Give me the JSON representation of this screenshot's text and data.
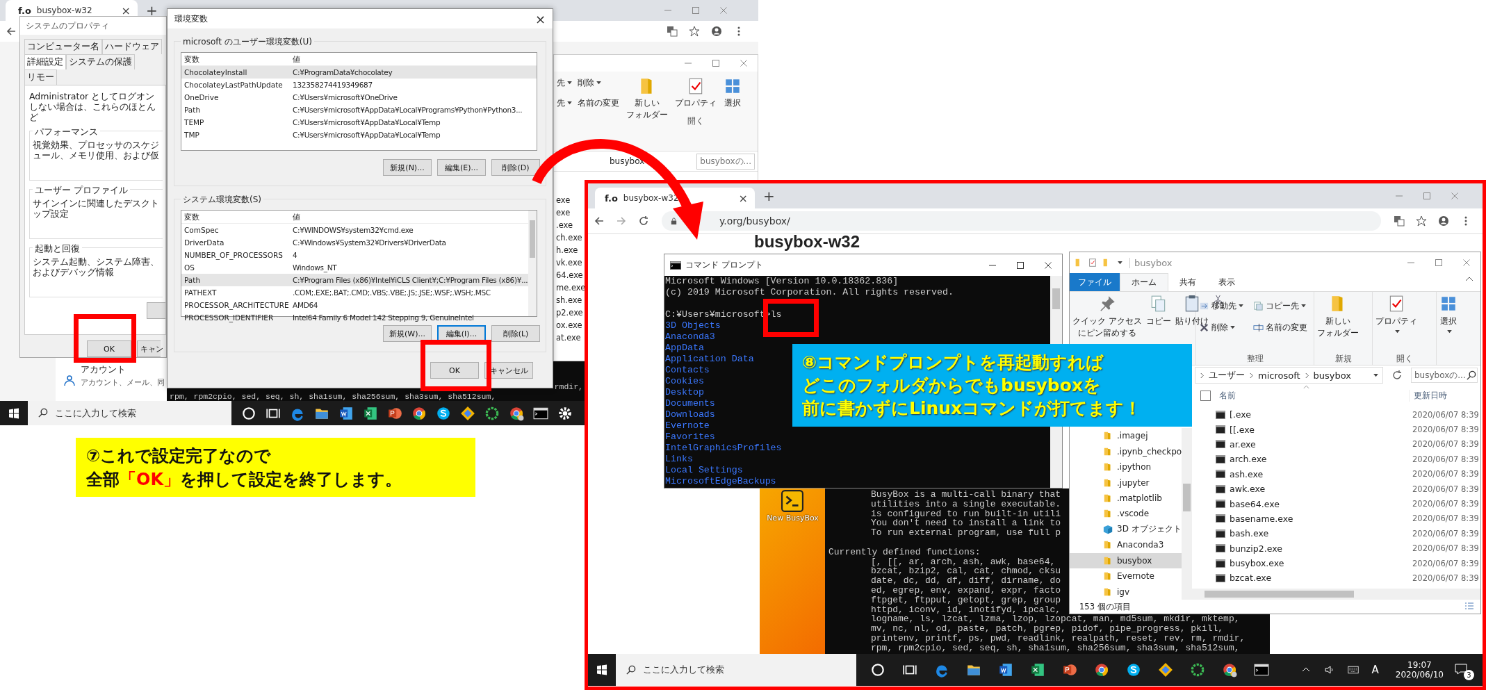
{
  "left_screenshot": {
    "browser_tab": {
      "logo": "f.o",
      "title": "busybox-w32",
      "close": "×",
      "new_tab": "+"
    },
    "system_properties": {
      "title": "システムのプロパティ",
      "tabs": [
        {
          "label": "コンピューター名",
          "selected": false
        },
        {
          "label": "ハードウェア",
          "selected": false
        },
        {
          "label": "詳細設定",
          "selected": true
        },
        {
          "label": "システムの保護",
          "selected": false
        },
        {
          "label": "リモー",
          "selected": false
        }
      ],
      "intro": "Administrator としてログオンしない場合は、これらのほとんど",
      "groups": [
        {
          "title": "パフォーマンス",
          "text": "視覚効果、プロセッサのスケジュール、メモリ使用、および仮"
        },
        {
          "title": "ユーザー プロファイル",
          "text": "サインインに関連したデスクトップ設定"
        },
        {
          "title": "起動と回復",
          "text": "システム起動、システム障害、およびデバッグ情報"
        }
      ],
      "buttons": [
        "OK",
        "キャン"
      ]
    },
    "settings_panel": {
      "title": "アカウント",
      "subtitle": "アカウント、メール、同"
    },
    "environment_variables": {
      "title": "環境変数",
      "close": "×",
      "sections": [
        {
          "title": "microsoft のユーザー環境変数(U)",
          "columns": [
            "変数",
            "値"
          ],
          "rows": [
            {
              "name": "ChocolateyInstall",
              "value": "C:¥ProgramData¥chocolatey",
              "selected": true
            },
            {
              "name": "ChocolateyLastPathUpdate",
              "value": "132358274419349687",
              "selected": false
            },
            {
              "name": "OneDrive",
              "value": "C:¥Users¥microsoft¥OneDrive",
              "selected": false
            },
            {
              "name": "Path",
              "value": "C:¥Users¥microsoft¥AppData¥Local¥Programs¥Python¥Python3...",
              "selected": false
            },
            {
              "name": "TEMP",
              "value": "C:¥Users¥microsoft¥AppData¥Local¥Temp",
              "selected": false
            },
            {
              "name": "TMP",
              "value": "C:¥Users¥microsoft¥AppData¥Local¥Temp",
              "selected": false
            }
          ],
          "buttons": [
            {
              "label": "新規(N)...",
              "focused": false
            },
            {
              "label": "編集(E)...",
              "focused": false
            },
            {
              "label": "削除(D)",
              "focused": false
            }
          ]
        },
        {
          "title": "システム環境変数(S)",
          "columns": [
            "変数",
            "値"
          ],
          "rows": [
            {
              "name": "ComSpec",
              "value": "C:¥WINDOWS¥system32¥cmd.exe",
              "selected": false
            },
            {
              "name": "DriverData",
              "value": "C:¥Windows¥System32¥Drivers¥DriverData",
              "selected": false
            },
            {
              "name": "NUMBER_OF_PROCESSORS",
              "value": "4",
              "selected": false
            },
            {
              "name": "OS",
              "value": "Windows_NT",
              "selected": false
            },
            {
              "name": "Path",
              "value": "C:¥Program Files (x86)¥Intel¥iCLS Client¥;C:¥Program Files (x86)¥...",
              "selected": true
            },
            {
              "name": "PATHEXT",
              "value": ".COM;.EXE;.BAT;.CMD;.VBS;.VBE;.JS;.JSE;.WSF;.WSH;.MSC",
              "selected": false
            },
            {
              "name": "PROCESSOR_ARCHITECTURE",
              "value": "AMD64",
              "selected": false
            },
            {
              "name": "PROCESSOR_IDENTIFIER",
              "value": "Intel64 Family 6 Model 142 Stepping 9, GenuineIntel",
              "selected": false
            }
          ],
          "buttons": [
            {
              "label": "新規(W)...",
              "focused": false
            },
            {
              "label": "編集(I)...",
              "focused": true
            },
            {
              "label": "削除(L)",
              "focused": false
            }
          ]
        }
      ],
      "buttons": [
        "OK",
        "キャンセル"
      ]
    },
    "background_explorer": {
      "ribbon": [
        {
          "label": "先",
          "dropdown": true
        },
        {
          "label": "削除",
          "dropdown": true
        },
        {
          "label": "先",
          "dropdown": true
        },
        {
          "label": "名前の変更",
          "dropdown": false
        }
      ],
      "new_folder": [
        "新しい",
        "フォルダー"
      ],
      "properties": "プロパティ",
      "open_group": "開く",
      "select": "選択",
      "breadcrumb": "busybox",
      "search_placeholder": "busyboxの...",
      "files": [
        "exe",
        "exe",
        ".exe",
        "ch.exe",
        "h.exe",
        "vk.exe",
        "64.exe",
        "me.exe",
        "sh.exe",
        "p2.exe",
        "ox.exe",
        "at.exe"
      ]
    },
    "terminal_fragment": {
      "lines": [
        "rmdir,",
        "rpm, rpm2cpio, sed, seq, sh, sha1sum, sha256sum, sha3sum, sha512sum,"
      ]
    },
    "taskbar": {
      "search_placeholder": "ここに入力して検索"
    }
  },
  "left_callout": {
    "lines": [
      [
        {
          "text": "⑦これで設定完了なので",
          "emphasis": false
        }
      ],
      [
        {
          "text": "全部",
          "emphasis": false
        },
        {
          "text": "「OK」",
          "emphasis": true
        },
        {
          "text": "を押して設定を終了します。",
          "emphasis": false
        }
      ]
    ]
  },
  "right_screenshot": {
    "browser": {
      "logo": "f.o",
      "tab_title": "busybox-w32",
      "tab_close": "×",
      "new_tab": "+",
      "url": "y.org/busybox/",
      "page_heading": "busybox-w32"
    },
    "command_prompt": {
      "title": "コマンド プロンプト",
      "header_lines": [
        "Microsoft Windows [Version 10.0.18362.836]",
        "(c) 2019 Microsoft Corporation. All rights reserved."
      ],
      "prompt": "C:¥Users¥microsoft>ls",
      "listing": [
        "3D Objects",
        "Anaconda3",
        "AppData",
        "Application Data",
        "Contacts",
        "Cookies",
        "Desktop",
        "Documents",
        "Downloads",
        "Evernote",
        "Favorites",
        "IntelGraphicsProfiles",
        "Links",
        "Local Settings",
        "MicrosoftEdgeBackups"
      ]
    },
    "callout": {
      "lines": [
        "⑧コマンドプロンプトを再起動すれば",
        "どこのフォルダからでもbusyboxを",
        "前に書かずにLinuxコマンドが打てます！"
      ]
    },
    "desktop_icon": {
      "label": "New BusyBox"
    },
    "busybox_terminal": {
      "intro_lines": [
        "BusyBox is a multi-call binary that",
        "utilities into a single executable.",
        "is configured to run built-in utili",
        "You don't need to install a link to",
        "To run external program, use full p"
      ],
      "heading": "Currently defined functions:",
      "function_lines": [
        "[, [[, ar, arch, ash, awk, base64,",
        "bzcat, bzip2, cal, cat, chmod, cksu",
        "date, dc, dd, df, diff, dirname, do",
        "ed, egrep, env, expand, expr, facto",
        "ftpget, ftpput, getopt, grep, group",
        "httpd, iconv, id, inotifyd, ipcalc,",
        "logname, ls, lzcat, lzma, lzop, lzopcat, man, md5sum, mkdir, mktemp,",
        "mv, nc, nl, od, paste, patch, pgrep, pidof, pipe_progress, pkill,",
        "printenv, printf, ps, pwd, readlink, realpath, reset, rev, rm, rmdir,",
        "rpm, rpm2cpio, sed, seq, sh, sha1sum, sha256sum, sha3sum, sha512sum,"
      ]
    },
    "explorer": {
      "title": "busybox",
      "ribbon_tabs": [
        {
          "label": "ファイル",
          "kind": "menu"
        },
        {
          "label": "ホーム",
          "kind": "tab",
          "selected": true
        },
        {
          "label": "共有",
          "kind": "tab",
          "selected": false
        },
        {
          "label": "表示",
          "kind": "tab",
          "selected": false
        }
      ],
      "ribbon_groups": [
        {
          "items": [
            {
              "kind": "pin",
              "lines": [
                "クイック アクセス",
                "にピン留めする"
              ],
              "dropdown": false
            },
            {
              "kind": "copy",
              "lines": [
                "コピー"
              ],
              "dropdown": false
            },
            {
              "kind": "paste",
              "lines": [
                "貼り付け"
              ],
              "dropdown": false
            }
          ]
        },
        {
          "label": "整理",
          "items": [
            {
              "kind": "move",
              "lines": [
                "移動先"
              ],
              "dropdown": true
            },
            {
              "kind": "copyto",
              "lines": [
                "コピー先"
              ],
              "dropdown": true
            },
            {
              "kind": "delete",
              "lines": [
                "削除"
              ],
              "dropdown": true
            },
            {
              "kind": "rename",
              "lines": [
                "名前の変更"
              ],
              "dropdown": false
            }
          ]
        },
        {
          "label": "新規",
          "items": [
            {
              "kind": "newfolder",
              "lines": [
                "新しい",
                "フォルダー"
              ],
              "dropdown": false
            }
          ]
        },
        {
          "label": "開く",
          "items": [
            {
              "kind": "properties",
              "lines": [
                "プロパティ"
              ],
              "dropdown": true
            }
          ]
        },
        {
          "items": [
            {
              "kind": "select",
              "lines": [
                "選択"
              ],
              "dropdown": true
            }
          ]
        }
      ],
      "breadcrumb": [
        "ユーザー",
        "microsoft",
        "busybox"
      ],
      "search_placeholder": "busyboxの...",
      "nav": [
        {
          "label": ".imagej",
          "kind": "folder",
          "selected": false
        },
        {
          "label": ".ipynb_checkpo",
          "kind": "folder",
          "selected": false
        },
        {
          "label": ".ipython",
          "kind": "folder",
          "selected": false
        },
        {
          "label": ".jupyter",
          "kind": "folder",
          "selected": false
        },
        {
          "label": ".matplotlib",
          "kind": "folder",
          "selected": false
        },
        {
          "label": ".vscode",
          "kind": "folder",
          "selected": false
        },
        {
          "label": "3D オブジェクト",
          "kind": "objects3d",
          "selected": false
        },
        {
          "label": "Anaconda3",
          "kind": "folder",
          "selected": false
        },
        {
          "label": "busybox",
          "kind": "folder",
          "selected": true
        },
        {
          "label": "Evernote",
          "kind": "folder",
          "selected": false
        },
        {
          "label": "igv",
          "kind": "folder",
          "selected": false
        }
      ],
      "select_all": {
        "checked": false
      },
      "columns": [
        "名前",
        "更新日時"
      ],
      "files": [
        {
          "name": "[.exe",
          "date": "2020/06/07 8:39"
        },
        {
          "name": "[[.exe",
          "date": "2020/06/07 8:39"
        },
        {
          "name": "ar.exe",
          "date": "2020/06/07 8:39"
        },
        {
          "name": "arch.exe",
          "date": "2020/06/07 8:39"
        },
        {
          "name": "ash.exe",
          "date": "2020/06/07 8:39"
        },
        {
          "name": "awk.exe",
          "date": "2020/06/07 8:39"
        },
        {
          "name": "base64.exe",
          "date": "2020/06/07 8:39"
        },
        {
          "name": "basename.exe",
          "date": "2020/06/07 8:39"
        },
        {
          "name": "bash.exe",
          "date": "2020/06/07 8:39"
        },
        {
          "name": "bunzip2.exe",
          "date": "2020/06/07 8:39"
        },
        {
          "name": "busybox.exe",
          "date": "2020/06/07 8:39"
        },
        {
          "name": "bzcat.exe",
          "date": "2020/06/07 8:39"
        }
      ],
      "status": "153 個の項目"
    },
    "taskbar": {
      "search_placeholder": "ここに入力して検索",
      "ime": "A",
      "time": "19:07",
      "date": "2020/06/10",
      "notifications": "3"
    }
  }
}
